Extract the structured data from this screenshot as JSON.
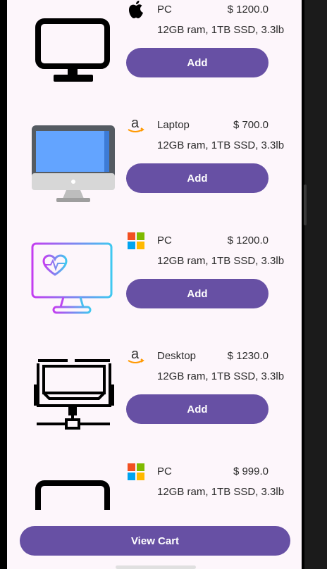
{
  "products": [
    {
      "brand_icon": "apple-icon",
      "name": "PC",
      "price": "$ 1200.0",
      "specs": "12GB ram, 1TB SSD, 3.3lb",
      "button": "Add",
      "thumb_icon": "monitor-outline-icon"
    },
    {
      "brand_icon": "amazon-icon",
      "name": "Laptop",
      "price": "$ 700.0",
      "specs": "12GB ram, 1TB SSD, 3.3lb",
      "button": "Add",
      "thumb_icon": "imac-icon"
    },
    {
      "brand_icon": "windows-icon",
      "name": "PC",
      "price": "$ 1200.0",
      "specs": "12GB ram, 1TB SSD, 3.3lb",
      "button": "Add",
      "thumb_icon": "health-monitor-icon"
    },
    {
      "brand_icon": "amazon-icon",
      "name": "Desktop",
      "price": "$ 1230.0",
      "specs": "12GB ram, 1TB SSD, 3.3lb",
      "button": "Add",
      "thumb_icon": "desktop-network-icon"
    },
    {
      "brand_icon": "windows-icon",
      "name": "PC",
      "price": "$ 999.0",
      "specs": "12GB ram, 1TB SSD, 3.3lb",
      "button": "Add",
      "thumb_icon": "monitor-outline-icon"
    }
  ],
  "cart": {
    "label": "View Cart"
  },
  "colors": {
    "accent": "#6750a4",
    "background": "#fdf6fb"
  }
}
